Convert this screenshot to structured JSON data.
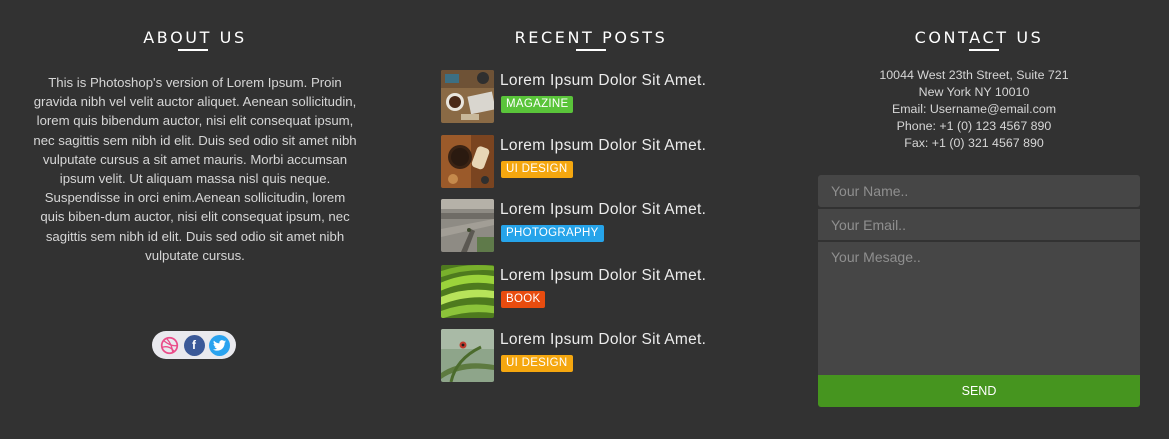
{
  "about": {
    "title": "ABOUT US",
    "text": "This is Photoshop's version  of Lorem Ipsum. Proin gravida nibh vel velit auctor aliquet. Aenean sollicitudin, lorem quis bibendum auctor, nisi elit consequat ipsum, nec sagittis sem nibh id elit. Duis sed odio sit amet nibh vulputate cursus a sit amet mauris. Morbi accumsan ipsum velit. Ut aliquam massa nisl quis neque. Suspendisse in orci enim.Aenean sollicitudin, lorem quis biben-dum auctor, nisi elit consequat ipsum, nec sagittis sem nibh id elit. Duis sed odio sit amet nibh vulputate cursus.",
    "social": [
      {
        "icon": "dribbble-icon",
        "color": "#ea4c89"
      },
      {
        "icon": "facebook-icon",
        "color": "#3b5998",
        "glyph": "f"
      },
      {
        "icon": "twitter-icon",
        "color": "#2aa3ef"
      }
    ]
  },
  "posts": {
    "title": "RECENT POSTS",
    "items": [
      {
        "title": "Lorem Ipsum Dolor Sit Amet.",
        "tag": "MAGAZINE",
        "tag_color": "#5ac43a"
      },
      {
        "title": "Lorem Ipsum Dolor Sit Amet.",
        "tag": "UI DESIGN",
        "tag_color": "#f5a70f"
      },
      {
        "title": "Lorem Ipsum Dolor Sit Amet.",
        "tag": "PHOTOGRAPHY",
        "tag_color": "#26a4ea"
      },
      {
        "title": "Lorem Ipsum Dolor Sit Amet.",
        "tag": "BOOK",
        "tag_color": "#e84c0f"
      },
      {
        "title": "Lorem Ipsum Dolor Sit Amet.",
        "tag": "UI DESIGN",
        "tag_color": "#f5a70f"
      }
    ]
  },
  "contact": {
    "title": "CONTACT US",
    "address_line1": "10044 West 23th Street, Suite 721",
    "address_line2": "New York NY 10010",
    "email": "Email: Username@email.com",
    "phone": "Phone: +1 (0) 123 4567 890",
    "fax": "Fax: +1 (0) 321 4567 890",
    "form": {
      "name_placeholder": "Your Name..",
      "email_placeholder": "Your Email..",
      "message_placeholder": "Your Mesage..",
      "send_label": "SEND"
    }
  },
  "colors": {
    "background": "#323232",
    "send_button": "#46951f",
    "input_background": "#464646"
  }
}
